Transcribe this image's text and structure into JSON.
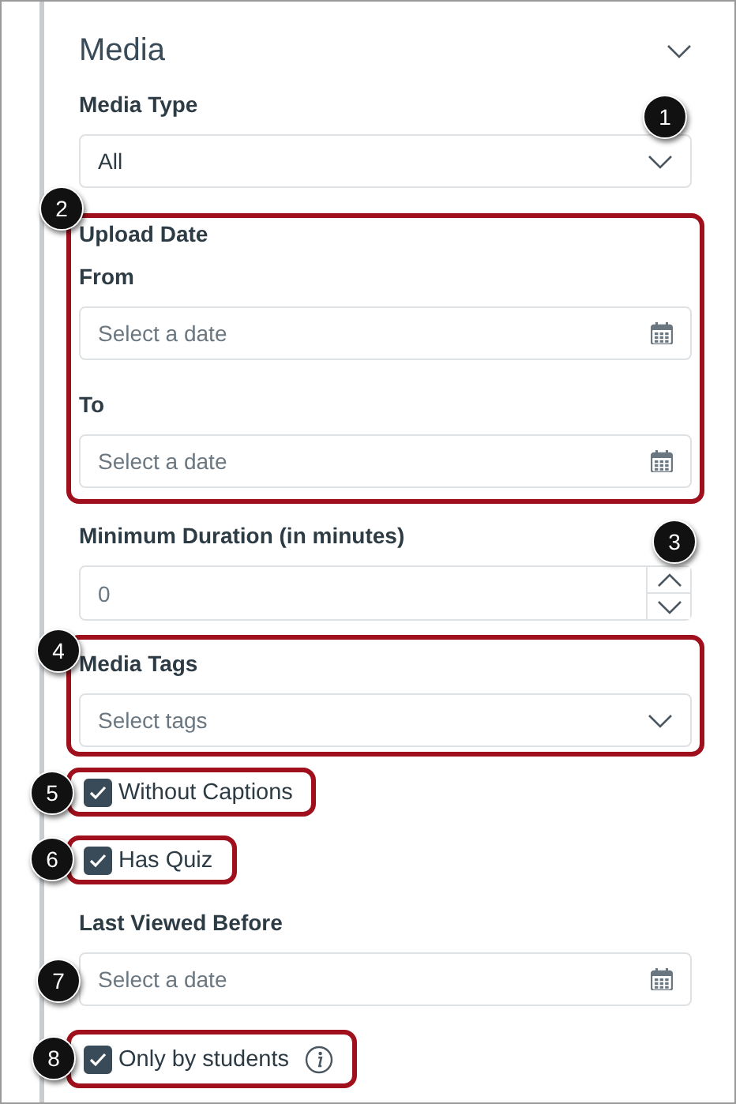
{
  "panel": {
    "title": "Media",
    "expanded": true
  },
  "fields": [
    {
      "kind": "select",
      "label": "Media Type",
      "value": "All",
      "highlighted": false,
      "callout": "1"
    },
    {
      "kind": "group",
      "label": "Upload Date",
      "highlighted": true,
      "callout": "2",
      "children": [
        {
          "kind": "date",
          "label": "From",
          "placeholder": "Select a date"
        },
        {
          "kind": "date",
          "label": "To",
          "placeholder": "Select a date"
        }
      ]
    },
    {
      "kind": "number",
      "label": "Minimum Duration (in minutes)",
      "placeholder": "0",
      "highlighted": false,
      "callout": "3"
    },
    {
      "kind": "select",
      "label": "Media Tags",
      "placeholder": "Select tags",
      "highlighted": true,
      "callout": "4"
    },
    {
      "kind": "checkbox",
      "label": "Without Captions",
      "checked": true,
      "highlighted": true,
      "callout": "5"
    },
    {
      "kind": "checkbox",
      "label": "Has Quiz",
      "checked": true,
      "highlighted": true,
      "callout": "6"
    },
    {
      "kind": "date",
      "label": "Last Viewed Before",
      "placeholder": "Select a date",
      "highlighted": false,
      "callout": "7"
    },
    {
      "kind": "checkbox",
      "label": "Only by students",
      "checked": true,
      "info": true,
      "highlighted": true,
      "callout": "8"
    }
  ]
}
